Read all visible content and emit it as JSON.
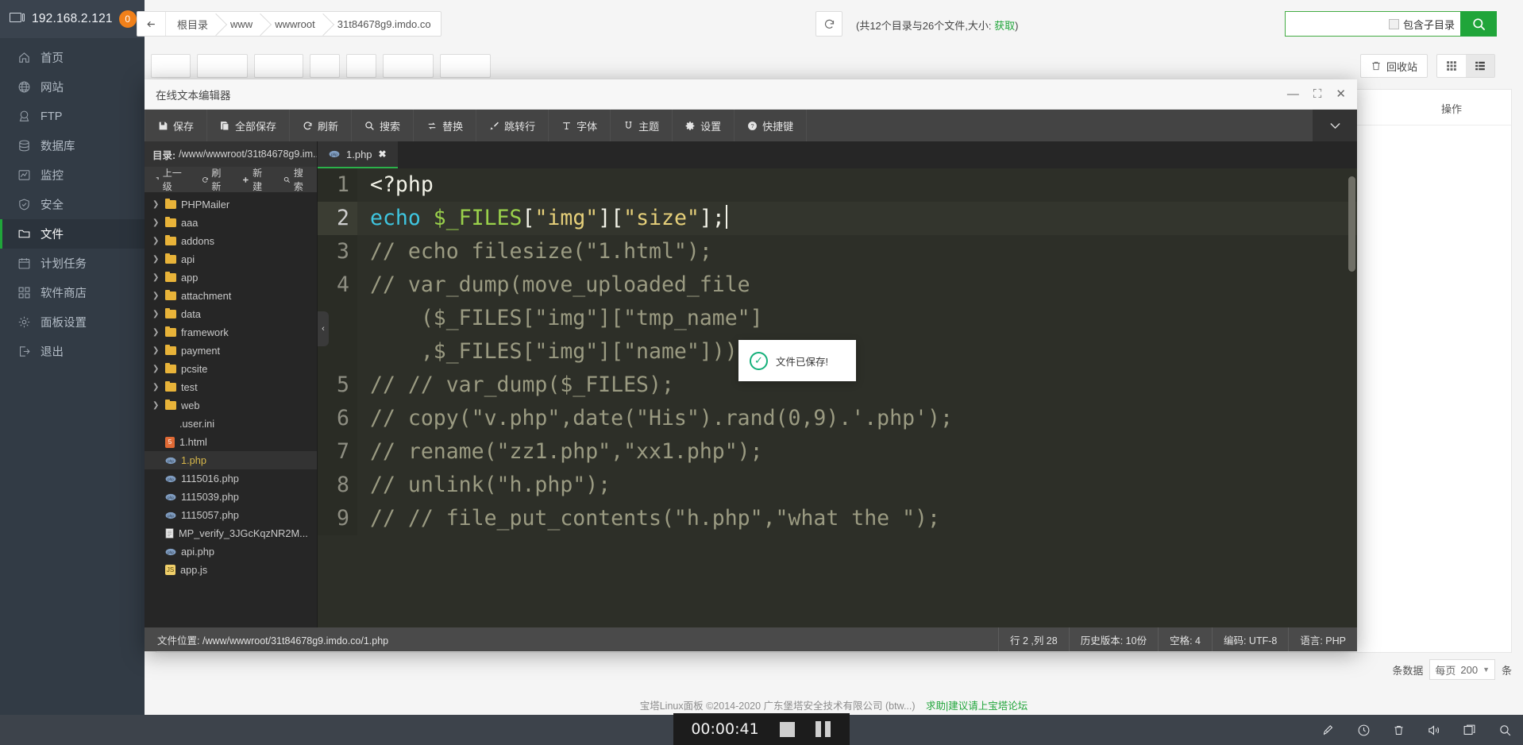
{
  "sidebar": {
    "host": "192.168.2.121",
    "badge": "0",
    "items": [
      {
        "label": "首页",
        "icon": "home-icon"
      },
      {
        "label": "网站",
        "icon": "globe-icon"
      },
      {
        "label": "FTP",
        "icon": "ftp-icon"
      },
      {
        "label": "数据库",
        "icon": "database-icon"
      },
      {
        "label": "监控",
        "icon": "chart-icon"
      },
      {
        "label": "安全",
        "icon": "shield-icon"
      },
      {
        "label": "文件",
        "icon": "folder-icon"
      },
      {
        "label": "计划任务",
        "icon": "calendar-icon"
      },
      {
        "label": "软件商店",
        "icon": "grid-icon"
      },
      {
        "label": "面板设置",
        "icon": "gear-icon"
      },
      {
        "label": "退出",
        "icon": "logout-icon"
      }
    ]
  },
  "filemanager": {
    "breadcrumb": [
      "根目录",
      "www",
      "wwwroot",
      "31t84678g9.imdo.co"
    ],
    "summary_prefix": "(共12个目录与26个文件,大小: ",
    "summary_link": "获取",
    "summary_suffix": ")",
    "search_value": "",
    "search_placeholder": "",
    "include_sub_label": "包含子目录",
    "recycle_label": "回收站",
    "table_op_header": "操作",
    "pagebar_count": "条数据",
    "pagebar_perpage": "每页",
    "pagebar_value": "200",
    "pagebar_unit": "条"
  },
  "footer": {
    "copyright": "宝塔Linux面板 ©2014-2020 广东堡塔安全技术有限公司 (btw...)",
    "link": "求助|建议请上宝塔论坛"
  },
  "editor": {
    "window_title": "在线文本编辑器",
    "toolbar": [
      {
        "label": "保存",
        "icon": "save-icon"
      },
      {
        "label": "全部保存",
        "icon": "save-all-icon"
      },
      {
        "label": "刷新",
        "icon": "refresh-icon"
      },
      {
        "label": "搜索",
        "icon": "search-icon"
      },
      {
        "label": "替换",
        "icon": "replace-icon"
      },
      {
        "label": "跳转行",
        "icon": "goto-line-icon"
      },
      {
        "label": "字体",
        "icon": "font-icon"
      },
      {
        "label": "主题",
        "icon": "theme-icon"
      },
      {
        "label": "设置",
        "icon": "gear-icon"
      },
      {
        "label": "快捷键",
        "icon": "help-icon"
      }
    ],
    "tree": {
      "path_label": "目录:",
      "path_value": "/www/wwwroot/31t84678g9.im...",
      "ops": [
        {
          "label": "上一级",
          "icon": "up-arrow-icon"
        },
        {
          "label": "刷新",
          "icon": "refresh-icon"
        },
        {
          "label": "新建",
          "icon": "plus-icon"
        },
        {
          "label": "搜索",
          "icon": "search-icon"
        }
      ],
      "nodes": [
        {
          "name": "PHPMailer",
          "type": "folder"
        },
        {
          "name": "aaa",
          "type": "folder"
        },
        {
          "name": "addons",
          "type": "folder"
        },
        {
          "name": "api",
          "type": "folder"
        },
        {
          "name": "app",
          "type": "folder"
        },
        {
          "name": "attachment",
          "type": "folder"
        },
        {
          "name": "data",
          "type": "folder"
        },
        {
          "name": "framework",
          "type": "folder"
        },
        {
          "name": "payment",
          "type": "folder"
        },
        {
          "name": "pcsite",
          "type": "folder"
        },
        {
          "name": "test",
          "type": "folder"
        },
        {
          "name": "web",
          "type": "folder"
        },
        {
          "name": ".user.ini",
          "type": "plain"
        },
        {
          "name": "1.html",
          "type": "html"
        },
        {
          "name": "1.php",
          "type": "php",
          "selected": true
        },
        {
          "name": "1115016.php",
          "type": "php"
        },
        {
          "name": "1115039.php",
          "type": "php"
        },
        {
          "name": "1115057.php",
          "type": "php"
        },
        {
          "name": "MP_verify_3JGcKqzNR2M...",
          "type": "text"
        },
        {
          "name": "api.php",
          "type": "php"
        },
        {
          "name": "app.js",
          "type": "js"
        }
      ]
    },
    "tab": {
      "label": "1.php",
      "close": "✖"
    },
    "code_lines": [
      {
        "num": "1",
        "current": false,
        "tokens": [
          {
            "t": "<?php",
            "c": "c-plain"
          }
        ]
      },
      {
        "num": "2",
        "current": true,
        "tokens": [
          {
            "t": "echo",
            "c": "c-kw"
          },
          {
            "t": " ",
            "c": "c-plain"
          },
          {
            "t": "$_FILES",
            "c": "c-var"
          },
          {
            "t": "[",
            "c": "c-plain"
          },
          {
            "t": "\"img\"",
            "c": "c-str"
          },
          {
            "t": "][",
            "c": "c-plain"
          },
          {
            "t": "\"size\"",
            "c": "c-str"
          },
          {
            "t": "];",
            "c": "c-plain"
          }
        ]
      },
      {
        "num": "3",
        "current": false,
        "tokens": [
          {
            "t": "// echo filesize(\"1.html\");",
            "c": "c-comment"
          }
        ]
      },
      {
        "num": "4",
        "current": false,
        "tokens": [
          {
            "t": "// var_dump(move_uploaded_file",
            "c": "c-comment"
          }
        ]
      },
      {
        "num": "",
        "current": false,
        "tokens": [
          {
            "t": "    ($_FILES[\"img\"][\"tmp_name\"]",
            "c": "c-comment"
          }
        ]
      },
      {
        "num": "",
        "current": false,
        "tokens": [
          {
            "t": "    ,$_FILES[\"img\"][\"name\"]));",
            "c": "c-comment"
          }
        ]
      },
      {
        "num": "5",
        "current": false,
        "tokens": [
          {
            "t": "// // var_dump($_FILES);",
            "c": "c-comment"
          }
        ]
      },
      {
        "num": "6",
        "current": false,
        "tokens": [
          {
            "t": "// copy(\"v.php\",date(\"His\").rand(0,9).'.php');",
            "c": "c-comment"
          }
        ]
      },
      {
        "num": "7",
        "current": false,
        "tokens": [
          {
            "t": "// rename(\"zz1.php\",\"xx1.php\");",
            "c": "c-comment"
          }
        ]
      },
      {
        "num": "8",
        "current": false,
        "tokens": [
          {
            "t": "// unlink(\"h.php\");",
            "c": "c-comment"
          }
        ]
      },
      {
        "num": "9",
        "current": false,
        "tokens": [
          {
            "t": "// // file_put_contents(\"h.php\",\"what the \");",
            "c": "c-comment"
          }
        ]
      }
    ],
    "toast": {
      "message": "文件已保存!",
      "icon": "check-circle-icon"
    },
    "status": {
      "location_label": "文件位置:",
      "location_value": "/www/wwwroot/31t84678g9.imdo.co/1.php",
      "cursor": "行 2 ,列 28",
      "history": "历史版本: 10份",
      "indent": "空格: 4",
      "encoding": "编码: UTF-8",
      "language": "语言: PHP"
    }
  },
  "recorder": {
    "time": "00:00:41",
    "stop_icon": "stop-icon",
    "pause_icon": "pause-icon"
  },
  "taskbar": {
    "tray": [
      "rocket-icon",
      "compass-icon",
      "trash-icon",
      "volume-icon",
      "window-icon",
      "search-icon"
    ]
  }
}
